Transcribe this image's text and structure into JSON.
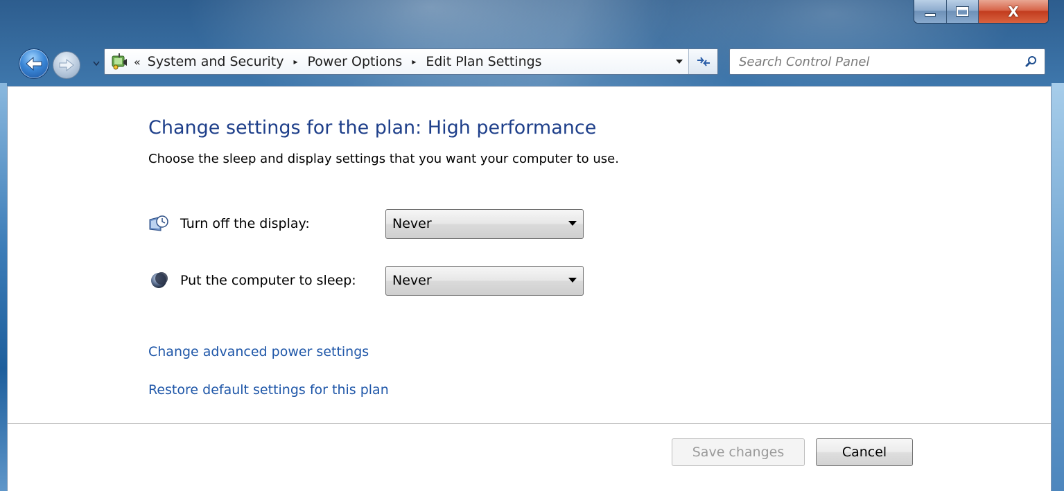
{
  "window": {
    "caption": {
      "minimize_icon": "minimize-icon",
      "maximize_icon": "maximize-icon",
      "close_glyph": "X"
    }
  },
  "navigation": {
    "back_icon": "back-arrow-icon",
    "forward_icon": "forward-arrow-icon"
  },
  "address_bar": {
    "icon": "power-options-icon",
    "overflow_chevrons": "«",
    "breadcrumbs": [
      "System and Security",
      "Power Options",
      "Edit Plan Settings"
    ],
    "separator_glyph": "▸",
    "dropdown_glyph": "▾"
  },
  "search": {
    "placeholder": "Search Control Panel",
    "value": ""
  },
  "main": {
    "title": "Change settings for the plan: High performance",
    "subtitle": "Choose the sleep and display settings that you want your computer to use.",
    "settings": [
      {
        "icon": "display-timer-icon",
        "label": "Turn off the display:",
        "selected": "Never"
      },
      {
        "icon": "sleep-moon-icon",
        "label": "Put the computer to sleep:",
        "selected": "Never"
      }
    ],
    "links": {
      "advanced": "Change advanced power settings",
      "restore": "Restore default settings for this plan"
    }
  },
  "footer": {
    "save_label": "Save changes",
    "save_enabled": false,
    "cancel_label": "Cancel"
  },
  "colors": {
    "title_blue": "#1e3f8a",
    "link_blue": "#1e56a8",
    "disabled_text": "#9a9a9a"
  }
}
